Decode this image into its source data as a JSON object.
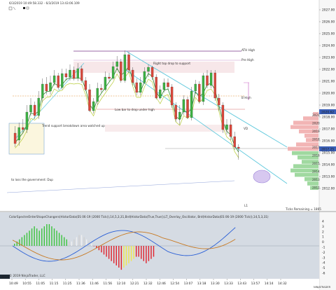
{
  "header": {
    "title": "6/3/2019 10:49:58.332 - 6/3/2019 13:43:06.109"
  },
  "annotations": {
    "ath": "ATH High",
    "pre_high": "Pre High",
    "b_high": "B High",
    "right_top": "Right top drop to support",
    "low_bar_drop": "Low bar to drop under high",
    "trend_support": "Trend support breakdown area watched up",
    "bottom_text": "to loss the government: Dup",
    "l1": "L1",
    "ticks_remaining": "Ticks Remaining = 1865",
    "vd": "VD"
  },
  "price_axis": {
    "ticks": [
      "2027.00",
      "2026.00",
      "2025.00",
      "2024.00",
      "2023.00",
      "2022.00",
      "2021.00",
      "2020.00",
      "2019.00",
      "2018.00",
      "2017.00",
      "2016.00",
      "2015.00",
      "2014.00",
      "2013.00",
      "2012.00"
    ],
    "current_price": "2020.62",
    "last_price": "2017.25"
  },
  "volume_profile": {
    "labels": [
      "2021",
      "2020",
      "2019",
      "2018",
      "2017",
      "2016",
      "2015",
      "2014",
      "2013",
      "2012"
    ]
  },
  "indicator": {
    "title": "ColorSpectreOrderShapeChangers(HistorData(ES 06-19 (2000 Tick)),14,5,3,31,Brd(HistorData(True,True)),LT_Overlay_Oscillator, Brd(HistorData(ES 06-19 (2000 Tick)),14,5,3,31)",
    "value_label": "-6.11",
    "ticks": [
      "4",
      "3",
      "2",
      "1",
      "0",
      "-1",
      "-2",
      "-3",
      "-4",
      "-5",
      "-6"
    ]
  },
  "time_axis": {
    "ticks": [
      "10:49",
      "10:55",
      "11:05",
      "11:15",
      "11:25",
      "11:36",
      "11:46",
      "11:56",
      "12:10",
      "12:21",
      "12:32",
      "12:46",
      "12:54",
      "13:07",
      "13:18",
      "13:30",
      "13:33",
      "13:43",
      "13:57",
      "14:14",
      "14:32"
    ]
  },
  "copyright": "© 2019 NinjaTrader, LLC",
  "watermark": "NINJATRADER",
  "colors": {
    "up_candle": "#3cb043",
    "down_candle": "#d9473b",
    "trend_lines": "#5ec8dc",
    "ath_line": "#7a3a8a",
    "indicator_bg": "#d5dbe3",
    "hist_green": "#39c33b",
    "hist_red": "#e0202a",
    "hist_yellow": "#f3e84a",
    "hist_white": "#f0f0f0"
  }
}
